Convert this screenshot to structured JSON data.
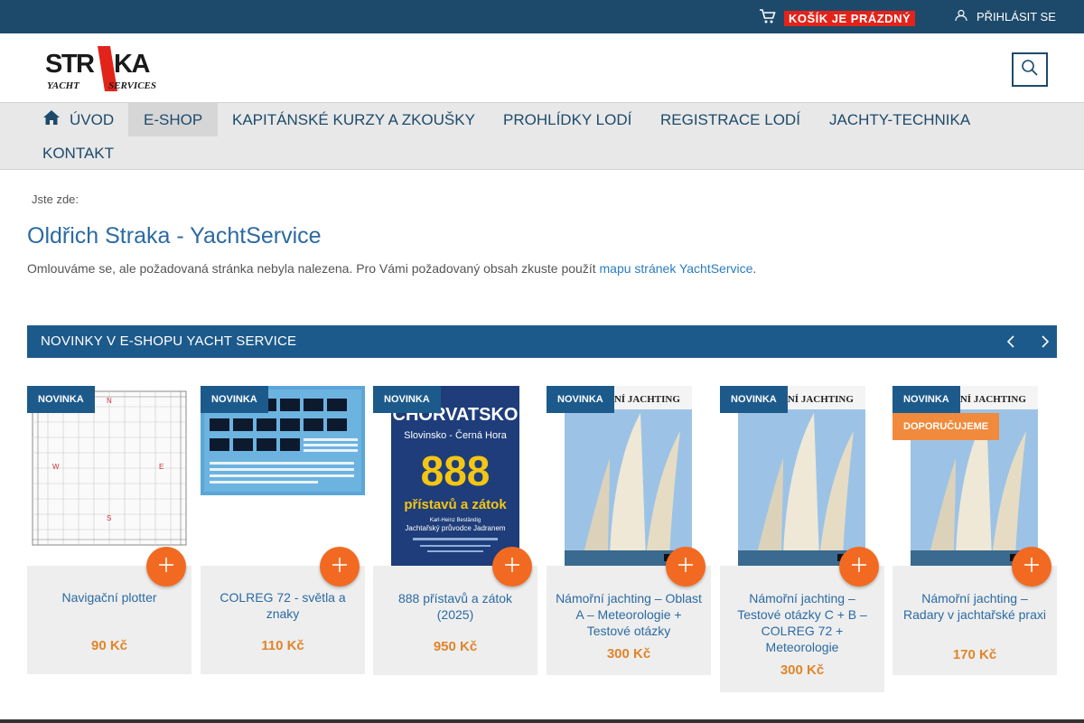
{
  "topbar": {
    "cart_label": "KOŠÍK JE PRÁZDNÝ",
    "login_label": "PŘIHLÁSIT SE"
  },
  "header": {
    "logo_text_main": "STRAKA",
    "logo_text_sub": "YACHT SERVICES"
  },
  "nav": {
    "items": [
      {
        "label": "ÚVOD"
      },
      {
        "label": "E-SHOP"
      },
      {
        "label": "KAPITÁNSKÉ KURZY A ZKOUŠKY"
      },
      {
        "label": "PROHLÍDKY LODÍ"
      },
      {
        "label": "REGISTRACE LODÍ"
      },
      {
        "label": "JACHTY-TECHNIKA"
      },
      {
        "label": "KONTAKT"
      }
    ]
  },
  "content": {
    "breadcrumb": "Jste zde:",
    "title": "Oldřich Straka - YachtService",
    "message_text": "Omlouváme se, ale požadovaná stránka nebyla nalezena. Pro Vámi požadovaný obsah zkuste použít ",
    "message_link": "mapu stránek YachtService",
    "message_end": "."
  },
  "section": {
    "title": "NOVINKY V E-SHOPU YACHT SERVICE"
  },
  "products": [
    {
      "name": "Navigační plotter",
      "price": "90 Kč",
      "badge_new": "NOVINKA"
    },
    {
      "name": "COLREG 72 - světla a znaky",
      "price": "110 Kč",
      "badge_new": "NOVINKA"
    },
    {
      "name": "888 přístavů a zátok (2025)",
      "price": "950 Kč",
      "badge_new": "NOVINKA"
    },
    {
      "name": "Námořní jachting – Oblast A – Meteorologie + Testové otázky",
      "price": "300 Kč",
      "badge_new": "NOVINKA"
    },
    {
      "name": "Námořní jachting – Testové otázky C + B – COLREG 72 + Meteorologie",
      "price": "300 Kč",
      "badge_new": "NOVINKA"
    },
    {
      "name": "Námořní jachting – Radary v jachtařské praxi",
      "price": "170 Kč",
      "badge_new": "NOVINKA",
      "badge_rec": "DOPORUČUJEME"
    }
  ],
  "book_covers": {
    "croatia_title": "CHORVATSKO",
    "croatia_sub": "Slovinsko - Černá Hora",
    "croatia_number": "888",
    "croatia_text": "přístavů a zátok",
    "croatia_author": "Karl-Heinz Beständig",
    "croatia_desc": "Jachtařský průvodce Jadranem",
    "jachting_title": "NÁMOŘNÍ JACHTING"
  },
  "colors": {
    "topbar": "#1d4a6b",
    "accent_blue": "#1d5a8c",
    "orange": "#f26a21",
    "price": "#e0852a",
    "badge_red": "#e2231a"
  }
}
